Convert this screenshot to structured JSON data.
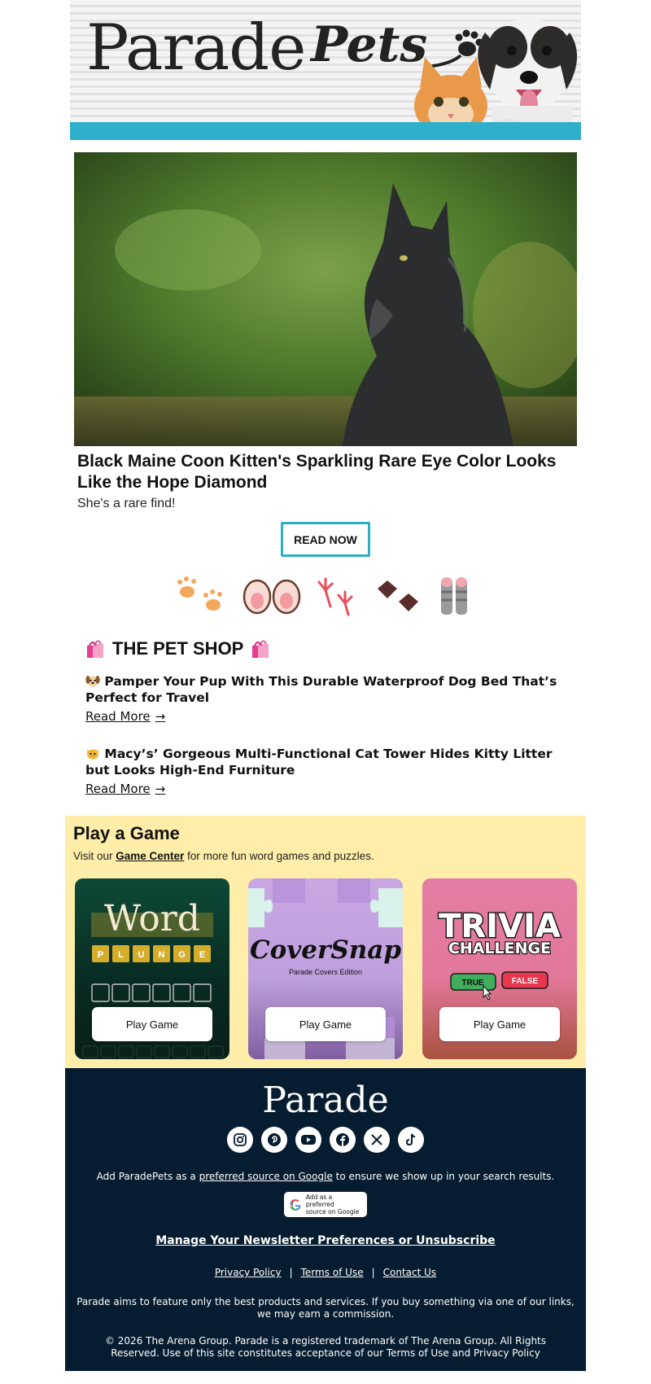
{
  "header": {
    "logo_word_1": "Parade",
    "logo_word_2": "Pets",
    "accent_color": "#2eb0cc"
  },
  "hero": {
    "image_subject": "black Maine Coon kitten",
    "title": "Black Maine Coon Kitten's Sparkling Rare Eye Color Looks Like the Hope Diamond",
    "dek": "She's a rare find!",
    "cta_label": "READ NOW",
    "cta_border_color": "#2eaec3"
  },
  "pet_shop": {
    "title": "THE PET SHOP",
    "title_icon": "shopping-bags-icon",
    "items": [
      {
        "icon": "dog-face-icon",
        "headline": "Pamper Your Pup With This Durable Waterproof Dog Bed That’s Perfect for Travel",
        "link_label": "Read More",
        "arrow": "→"
      },
      {
        "icon": "cat-face-icon",
        "headline": "Macy’s’ Gorgeous Multi-Functional Cat Tower Hides Kitty Litter but Looks High-End Furniture",
        "link_label": "Read More",
        "arrow": "→"
      }
    ]
  },
  "games": {
    "title": "Play a Game",
    "intro_prefix": "Visit our ",
    "intro_link": "Game Center",
    "intro_suffix": " for more fun word games and puzzles.",
    "background": "#feeeaa",
    "cards": [
      {
        "name": "Word Plunge",
        "title_top": "Word",
        "title_letters": [
          "P",
          "L",
          "U",
          "N",
          "G",
          "E"
        ],
        "button": "Play Game"
      },
      {
        "name": "CoverSnap",
        "title_top": "CoverSnap",
        "subtitle": "Parade Covers Edition",
        "button": "Play Game"
      },
      {
        "name": "Trivia Challenge",
        "title_top": "TRIVIA",
        "title_bottom": "CHALLENGE",
        "true_label": "TRUE",
        "false_label": "FALSE",
        "button": "Play Game"
      }
    ]
  },
  "footer": {
    "brand": "Parade",
    "background": "#061c30",
    "socials": [
      "instagram-icon",
      "pinterest-icon",
      "youtube-icon",
      "facebook-icon",
      "x-icon",
      "tiktok-icon"
    ],
    "source_prefix": "Add ParadePets as a ",
    "source_link": "preferred source on Google",
    "source_suffix": " to ensure we show up in your search results.",
    "badge_line_1": "Add as a preferred",
    "badge_line_2": "source on Google",
    "manage_label": "Manage Your Newsletter Preferences or Unsubscribe",
    "legal_links": [
      "Privacy Policy",
      "Terms of Use",
      "Contact Us"
    ],
    "legal_sep": "|",
    "disclaimer": "Parade aims to feature only the best products and services. If you buy something via one of our links, we may earn a commission.",
    "copyright": "© 2026 The Arena Group. Parade is a registered trademark of The Arena Group. All Rights Reserved. Use of this site constitutes acceptance of our Terms of Use and Privacy Policy"
  }
}
